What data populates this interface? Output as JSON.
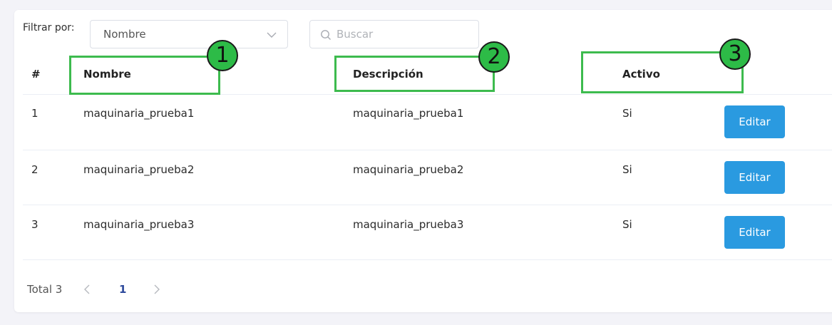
{
  "filter": {
    "label": "Filtrar por:",
    "selected": "Nombre",
    "search_placeholder": "Buscar",
    "search_value": ""
  },
  "table": {
    "columns": [
      "#",
      "Nombre",
      "Descripción",
      "Activo"
    ],
    "rows": [
      {
        "num": "1",
        "nombre": "maquinaria_prueba1",
        "descripcion": "maquinaria_prueba1",
        "activo": "Si",
        "action": "Editar"
      },
      {
        "num": "2",
        "nombre": "maquinaria_prueba2",
        "descripcion": "maquinaria_prueba2",
        "activo": "Si",
        "action": "Editar"
      },
      {
        "num": "3",
        "nombre": "maquinaria_prueba3",
        "descripcion": "maquinaria_prueba3",
        "activo": "Si",
        "action": "Editar"
      }
    ]
  },
  "pagination": {
    "total": "Total 3",
    "current_page": "1"
  },
  "annotations": [
    "1",
    "2",
    "3"
  ],
  "colors": {
    "edit_button": "#2a9ae0",
    "annotation_green": "#3dbb4e",
    "active_page": "#2e4a9c"
  },
  "icons": {
    "select": "chevron-down-icon",
    "search": "search-icon",
    "prev": "chevron-left-icon",
    "next": "chevron-right-icon"
  }
}
